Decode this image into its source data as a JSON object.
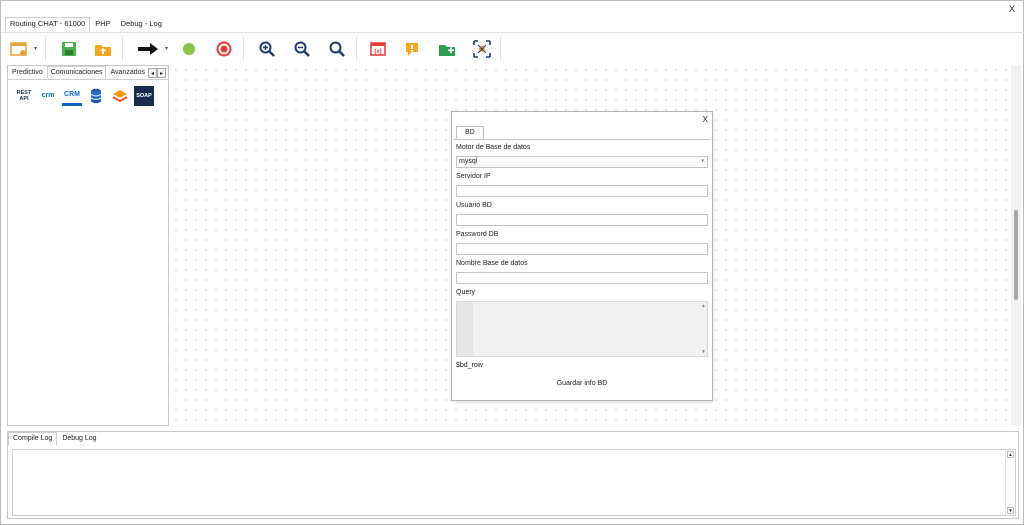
{
  "window": {
    "close_label": "X"
  },
  "top_tabs": [
    {
      "label": "Routing CHAT - 61000"
    },
    {
      "label": "PHP"
    },
    {
      "label": "Debug - Log"
    }
  ],
  "toolbar": {
    "icons": [
      "new-flow-icon",
      "save-icon",
      "open-folder-icon",
      "arrow-right-icon",
      "green-circle-icon",
      "record-stop-icon",
      "zoom-in-icon",
      "zoom-out-icon",
      "zoom-reset-icon",
      "variable-icon",
      "alert-icon",
      "add-folder-icon",
      "fit-view-icon"
    ]
  },
  "left_panel": {
    "tabs": [
      {
        "label": "Predictivo"
      },
      {
        "label": "Comunicaciones"
      },
      {
        "label": "Avanzados"
      }
    ],
    "components": [
      {
        "name": "rest-api-icon",
        "text": "REST API"
      },
      {
        "name": "crm-amazon-icon",
        "text": "crm"
      },
      {
        "name": "crm-connect-icon",
        "text": "CRM"
      },
      {
        "name": "database-icon",
        "text": ""
      },
      {
        "name": "layers-icon",
        "text": ""
      },
      {
        "name": "soap-icon",
        "text": "SOAP"
      }
    ]
  },
  "dialog": {
    "close_label": "X",
    "tab_label": "BD",
    "fields": {
      "engine_label": "Motor de Base de datos",
      "engine_value": "mysql",
      "server_label": "Servidor IP",
      "user_label": "Usuario BD",
      "password_label": "Password DB",
      "dbname_label": "Nombre Base de datos",
      "query_label": "Query"
    },
    "row_var": "$bd_row",
    "save_label": "Guardar info BD"
  },
  "bottom_panel": {
    "tabs": [
      {
        "label": "Compile Log"
      },
      {
        "label": "Debug Log"
      }
    ]
  },
  "colors": {
    "save_green": "#4caf50",
    "open_orange": "#f5a623",
    "stop_red": "#e53935",
    "go_green": "#8bc34a",
    "zoom_navy": "#1f3a6b"
  }
}
